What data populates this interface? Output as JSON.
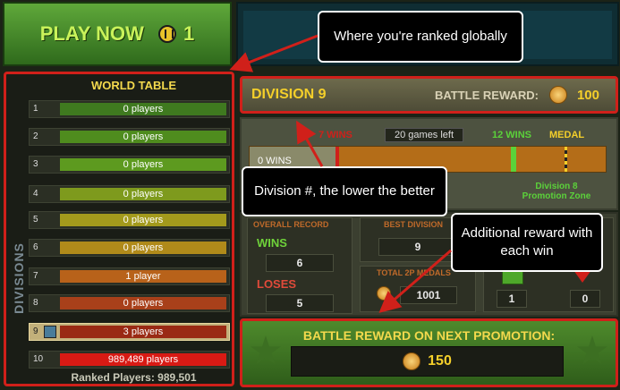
{
  "play_now": {
    "label": "PLAY NOW",
    "tickets": "1",
    "ticket_icon": "ticket-icon"
  },
  "world_table": {
    "title": "WORLD TABLE",
    "side_label": "DIVISIONS",
    "rows": [
      {
        "num": "1",
        "text": "0 players",
        "color": "#3f7a1f"
      },
      {
        "num": "2",
        "text": "0 players",
        "color": "#4f8c1e"
      },
      {
        "num": "3",
        "text": "0 players",
        "color": "#5d9a1f"
      },
      {
        "num": "4",
        "text": "0 players",
        "color": "#7e9a1d"
      },
      {
        "num": "5",
        "text": "0 players",
        "color": "#a39a1c"
      },
      {
        "num": "6",
        "text": "0 players",
        "color": "#b08a1a"
      },
      {
        "num": "7",
        "text": "1 player",
        "color": "#b8621a"
      },
      {
        "num": "8",
        "text": "0 players",
        "color": "#a8401a"
      },
      {
        "num": "9",
        "text": "3 players",
        "color": "#9a2a14"
      },
      {
        "num": "10",
        "text": "989,489 players",
        "color": "#d81a14"
      }
    ],
    "ranked_label": "Ranked Players: 989,501"
  },
  "division": {
    "title": "DIVISION 9",
    "reward_label": "BATTLE REWARD:",
    "reward_value": "100"
  },
  "progress": {
    "zero_wins": "0 WINS",
    "seven_wins": "7 WINS",
    "games_left": "20 games left",
    "twelve_wins": "12 WINS",
    "medal": "MEDAL",
    "promo_line1": "Division 8",
    "promo_line2": "Promotion Zone"
  },
  "stats": {
    "overall_record": "OVERALL RECORD",
    "wins_label": "WINS",
    "wins_value": "6",
    "loses_label": "LOSES",
    "loses_value": "5",
    "best_division_label": "BEST DIVISION",
    "best_division_value": "9",
    "medals_label": "TOTAL 2P MEDALS",
    "medals_value": "1001",
    "thumbs_up_value": "1",
    "thumbs_down_value": "0"
  },
  "next_promotion": {
    "title": "BATTLE REWARD ON NEXT PROMOTION:",
    "value": "150"
  },
  "callouts": {
    "global_rank": "Where you're ranked globally",
    "division_num": "Division #, the lower the better",
    "additional_reward": "Additional reward with each win"
  },
  "colors": {
    "accent_red": "#d0201a",
    "gold": "#f4cf2a",
    "green": "#4e8a2c"
  }
}
